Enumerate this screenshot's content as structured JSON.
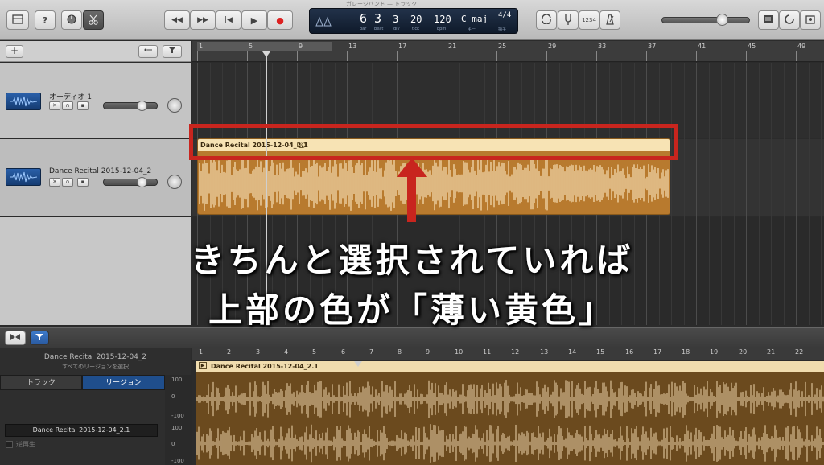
{
  "window": {
    "title": "ガレージバンド — トラック"
  },
  "toolbar": {
    "library_icon": "library-icon",
    "help_label": "?",
    "smart_controls_icon": "knob-icon",
    "editor_icon": "scissors-icon",
    "transport": {
      "rewind": "◀◀",
      "forward": "▶▶",
      "to_start": "|◀",
      "play": "▶",
      "record": "●"
    },
    "lcd": {
      "bar": "6",
      "beat": "3",
      "div": "3",
      "tick": "20",
      "tempo": "120",
      "key": "C maj",
      "signature": "4/4",
      "bar_lbl": "bar",
      "beat_lbl": "beat",
      "div_lbl": "div",
      "tick_lbl": "tick",
      "tempo_lbl": "bpm",
      "key_lbl": "キー",
      "sig_lbl": "拍子"
    },
    "count_in": "1234",
    "master_volume_fraction": 0.62
  },
  "tracks_header": {
    "add_label": "+"
  },
  "tracks": [
    {
      "name": "オーディオ 1",
      "volume_fraction": 0.7
    },
    {
      "name": "Dance Recital 2015-12-04_2",
      "volume_fraction": 0.7
    }
  ],
  "ruler": {
    "bars": [
      "1",
      "5",
      "9",
      "13",
      "17",
      "21",
      "25",
      "29",
      "33",
      "37",
      "41",
      "45",
      "49"
    ]
  },
  "region": {
    "name": "Dance Recital 2015-12-04_2.1",
    "loop_badge": "⊘"
  },
  "editor": {
    "track_title": "Dance Recital 2015-12-04_2",
    "subtitle": "すべてのリージョンを選択",
    "tab_track": "トラック",
    "tab_region": "リージョン",
    "region_field": "Dance Recital 2015-12-04_2.1",
    "checkbox_label": "逆再生",
    "axis": [
      "100",
      "0",
      "-100",
      "100",
      "0",
      "-100"
    ],
    "ruler_bars": [
      "1",
      "2",
      "3",
      "4",
      "5",
      "6",
      "7",
      "8",
      "9",
      "10",
      "11",
      "12",
      "13",
      "14",
      "15",
      "16",
      "17",
      "18",
      "19",
      "20",
      "21",
      "22"
    ],
    "region_name": "Dance Recital 2015-12-04_2.1"
  },
  "annotation": {
    "line1": "きちんと選択されていれば",
    "line2": "上部の色が「薄い黄色」",
    "color": "#c8251e"
  }
}
